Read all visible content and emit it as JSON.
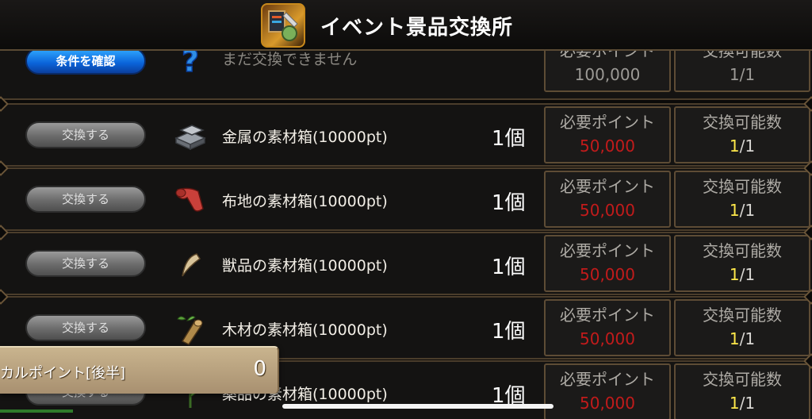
{
  "header": {
    "title": "イベント景品交換所",
    "logo_icon": "event-shop-emblem-icon"
  },
  "labels": {
    "points_required": "必要ポイント",
    "exchange_count": "交換可能数"
  },
  "rows": [
    {
      "button": "条件を確認",
      "button_style": "blue",
      "icon": "question-mark-icon",
      "name": "まだ交換できません",
      "quantity": "",
      "points": "100,000",
      "count_current": "",
      "count_total": "1/1"
    },
    {
      "button": "交換する",
      "button_style": "grey",
      "icon": "metal-ingot-icon",
      "name": "金属の素材箱(10000pt)",
      "quantity": "1個",
      "points": "50,000",
      "count_current": "1",
      "count_total": "/1"
    },
    {
      "button": "交換する",
      "button_style": "grey",
      "icon": "cloth-icon",
      "name": "布地の素材箱(10000pt)",
      "quantity": "1個",
      "points": "50,000",
      "count_current": "1",
      "count_total": "/1"
    },
    {
      "button": "交換する",
      "button_style": "grey",
      "icon": "fang-icon",
      "name": "獣品の素材箱(10000pt)",
      "quantity": "1個",
      "points": "50,000",
      "count_current": "1",
      "count_total": "/1"
    },
    {
      "button": "交換する",
      "button_style": "grey",
      "icon": "wood-log-icon",
      "name": "木材の素材箱(10000pt)",
      "quantity": "1個",
      "points": "50,000",
      "count_current": "1",
      "count_total": "/1"
    },
    {
      "button": "交換する",
      "button_style": "grey",
      "icon": "herb-icon",
      "name": "薬品の素材箱(10000pt)",
      "quantity": "1個",
      "points": "50,000",
      "count_current": "1",
      "count_total": "/1"
    }
  ],
  "overlay": {
    "label": "カルポイント[後半]",
    "value": "0"
  },
  "colors": {
    "points_red": "#c21b1b",
    "count_yellow": "#ffe84a",
    "confirm_blue": "#0a62d8"
  }
}
